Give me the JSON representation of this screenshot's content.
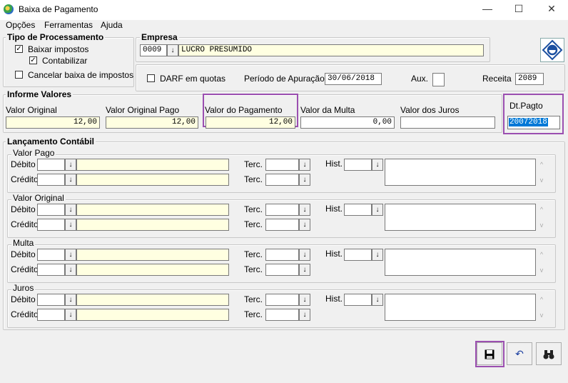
{
  "window": {
    "title": "Baixa de Pagamento",
    "minimize": "—",
    "maximize": "☐",
    "close": "✕"
  },
  "menu": [
    "Opções",
    "Ferramentas",
    "Ajuda"
  ],
  "tipo": {
    "title": "Tipo de Processamento",
    "baixar": "Baixar impostos",
    "baixar_checked": "✓",
    "contabilizar": "Contabilizar",
    "contabilizar_checked": "✓",
    "cancelar": "Cancelar baixa de impostos"
  },
  "empresa": {
    "title": "Empresa",
    "code": "0009",
    "name": "LUCRO PRESUMIDO"
  },
  "quotas": {
    "darf": "DARF em quotas",
    "periodo_label": "Período de Apuração",
    "periodo": "30/06/2018",
    "aux_label": "Aux.",
    "receita_label": "Receita",
    "receita": "2089"
  },
  "informe": {
    "title": "Informe Valores",
    "valor_original_label": "Valor Original",
    "valor_original": "12,00",
    "valor_original_pago_label": "Valor Original Pago",
    "valor_original_pago": "12,00",
    "valor_pagamento_label": "Valor do Pagamento",
    "valor_pagamento": "12,00",
    "valor_multa_label": "Valor da Multa",
    "valor_multa": "0,00",
    "valor_juros_label": "Valor dos Juros",
    "valor_juros": "",
    "dtpagto_label": "Dt.Pagto",
    "dtpagto": "20072018"
  },
  "lancamento": {
    "title": "Lançamento Contábil",
    "debito": "Débito",
    "credito": "Crédito",
    "terc": "Terc.",
    "hist": "Hist.",
    "groups": [
      "Valor Pago",
      "Valor Original",
      "Multa",
      "Juros"
    ]
  },
  "icons": {
    "dropdown": "↓",
    "save": "💾",
    "undo": "↶",
    "find": "binoculars-icon"
  }
}
